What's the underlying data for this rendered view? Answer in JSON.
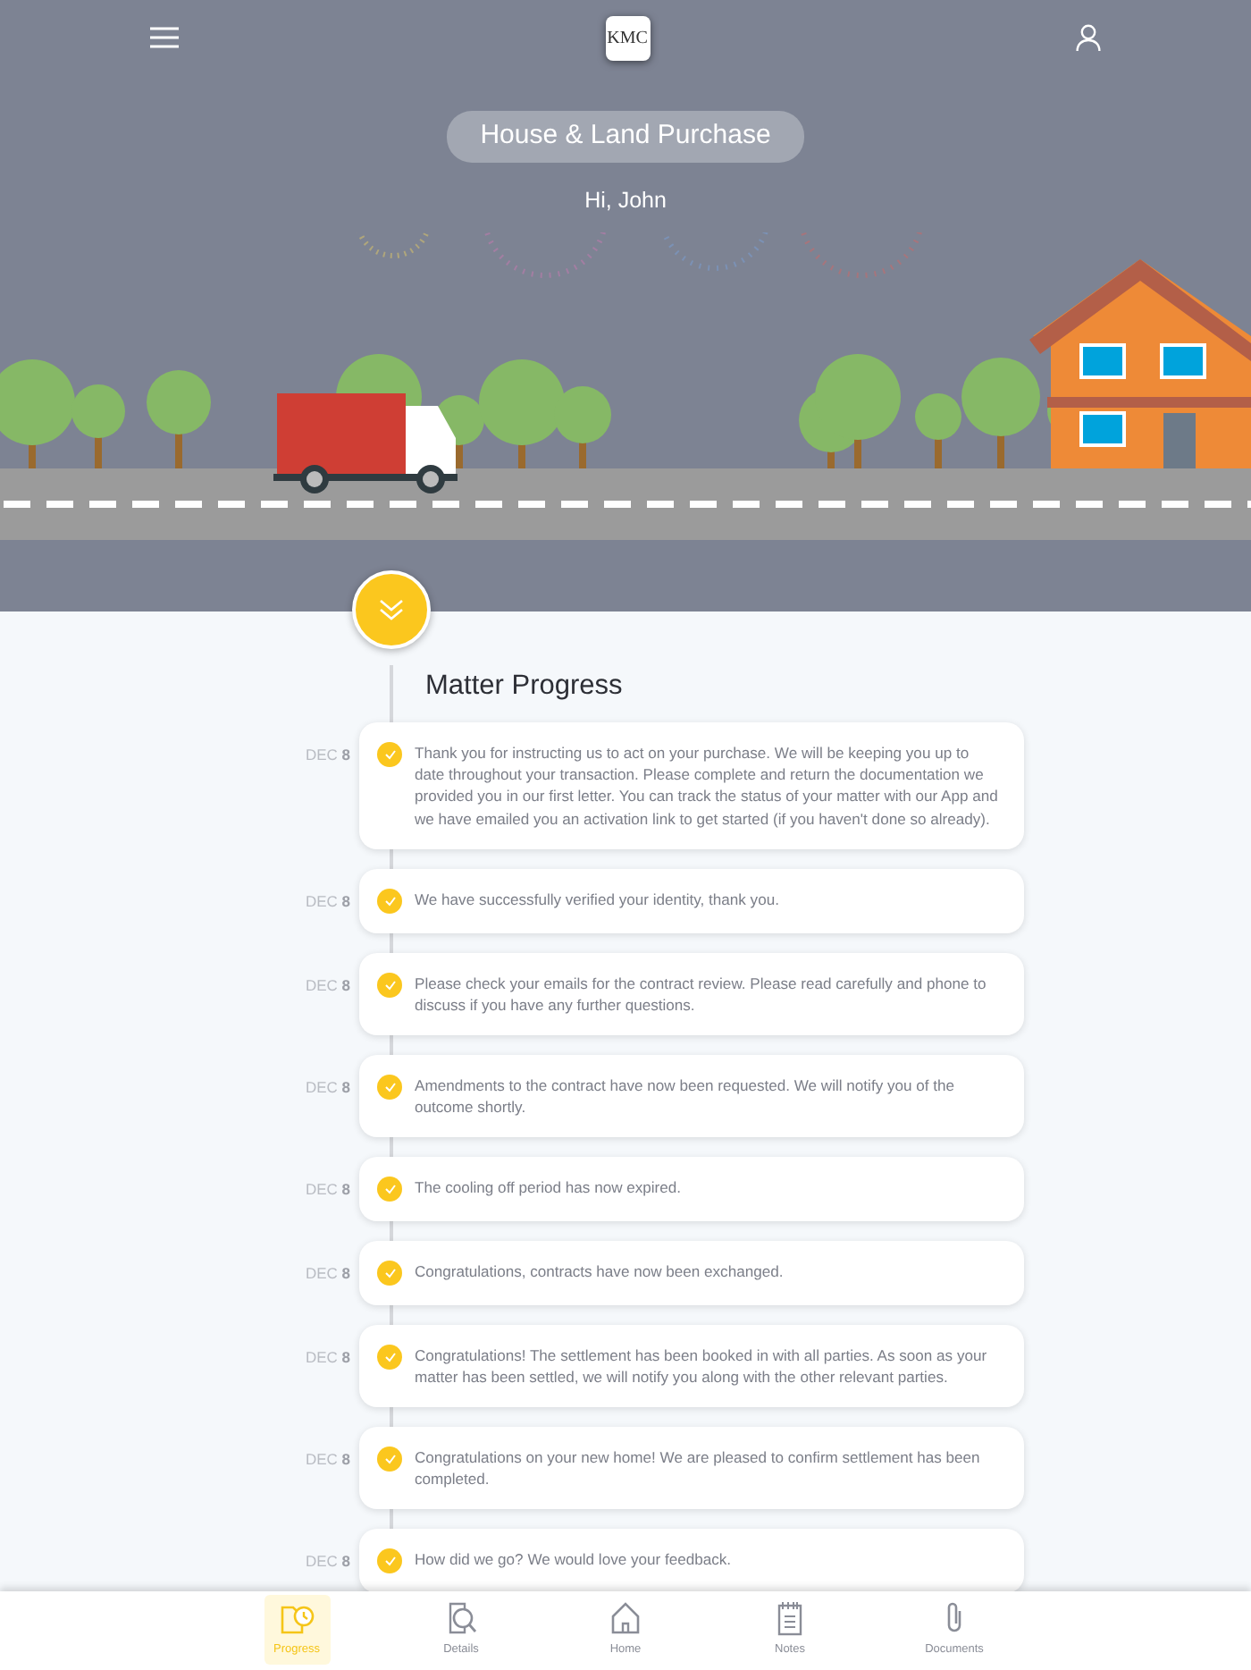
{
  "header": {
    "logo_text": "KMC",
    "title": "House & Land Purchase",
    "greeting": "Hi, John"
  },
  "timeline": {
    "heading": "Matter Progress",
    "entries": [
      {
        "month": "DEC",
        "day": "8",
        "text": "Thank you for instructing us to act on your purchase. We will be keeping you up to date throughout your transaction. Please complete and return the documentation we provided you in our first letter. You can track the status of your matter with our App and we have emailed you an activation link to get started (if you haven't done so already).",
        "done": true
      },
      {
        "month": "DEC",
        "day": "8",
        "text": "We have successfully verified your identity, thank you.",
        "done": true
      },
      {
        "month": "DEC",
        "day": "8",
        "text": "Please check your emails for the contract review. Please read carefully and phone to discuss if you have any further questions.",
        "done": true
      },
      {
        "month": "DEC",
        "day": "8",
        "text": "Amendments to the contract have now been requested. We will notify you of the outcome shortly.",
        "done": true
      },
      {
        "month": "DEC",
        "day": "8",
        "text": "The cooling off period has now expired.",
        "done": true
      },
      {
        "month": "DEC",
        "day": "8",
        "text": "Congratulations, contracts have now been exchanged.",
        "done": true
      },
      {
        "month": "DEC",
        "day": "8",
        "text": "Congratulations! The settlement has been booked in with all parties. As soon as your matter has been settled, we will notify you along with the other relevant parties.",
        "done": true
      },
      {
        "month": "DEC",
        "day": "8",
        "text": "Congratulations on your new home! We are pleased to confirm settlement has been completed.",
        "done": true
      },
      {
        "month": "DEC",
        "day": "8",
        "text": "How did we go? We would love your feedback.",
        "done": true
      }
    ]
  },
  "bottom_nav": [
    {
      "label": "Progress",
      "kind": "progress",
      "selected": true
    },
    {
      "label": "Details",
      "kind": "details",
      "selected": false
    },
    {
      "label": "Home",
      "kind": "home",
      "selected": false
    },
    {
      "label": "Notes",
      "kind": "notes",
      "selected": false
    },
    {
      "label": "Documents",
      "kind": "documents",
      "selected": false
    }
  ]
}
